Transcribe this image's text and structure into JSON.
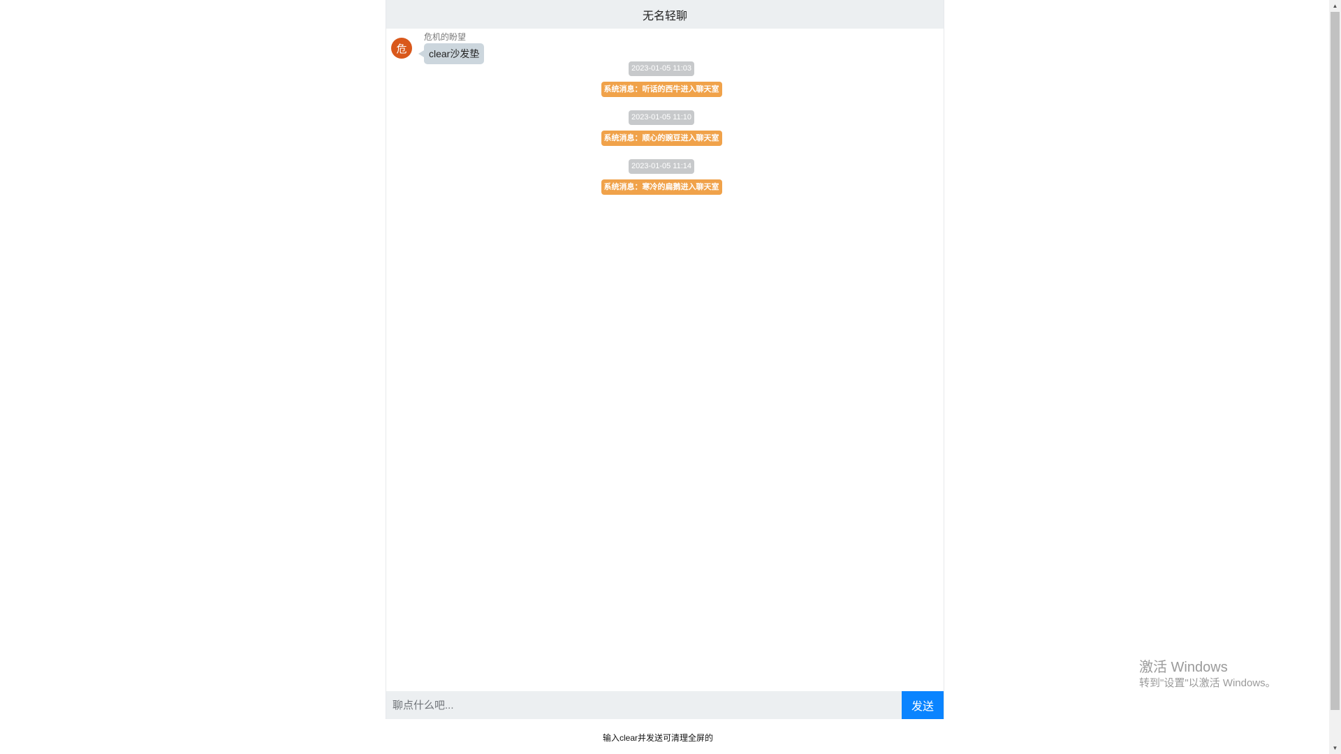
{
  "header": {
    "title": "无名轻聊"
  },
  "messages": {
    "user_message": {
      "avatar_char": "危",
      "sender": "危机的盼望",
      "text": "clear沙发垫"
    },
    "timestamps": [
      "2023-01-05 11:03",
      "2023-01-05 11:10",
      "2023-01-05 11:14"
    ],
    "system": [
      "系统消息：听话的西牛进入聊天室",
      "系统消息：顺心的豌豆进入聊天室",
      "系统消息：寒冷的扁鹅进入聊天室"
    ]
  },
  "input": {
    "placeholder": "聊点什么吧...",
    "value": ""
  },
  "send_label": "发送",
  "hint": "输入clear并发送可清理全屏的",
  "watermark": {
    "title": "激活 Windows",
    "subtitle": "转到\"设置\"以激活 Windows。"
  },
  "scrollbar": {
    "up_icon": "▲",
    "down_icon": "▼"
  },
  "colors": {
    "header_bg": "#eceff1",
    "avatar_bg": "#d9581b",
    "bubble_bg": "#ccd6dd",
    "timestamp_bg": "#c7c9cb",
    "system_bg": "#f0a24a",
    "send_bg": "#0a84ff"
  }
}
